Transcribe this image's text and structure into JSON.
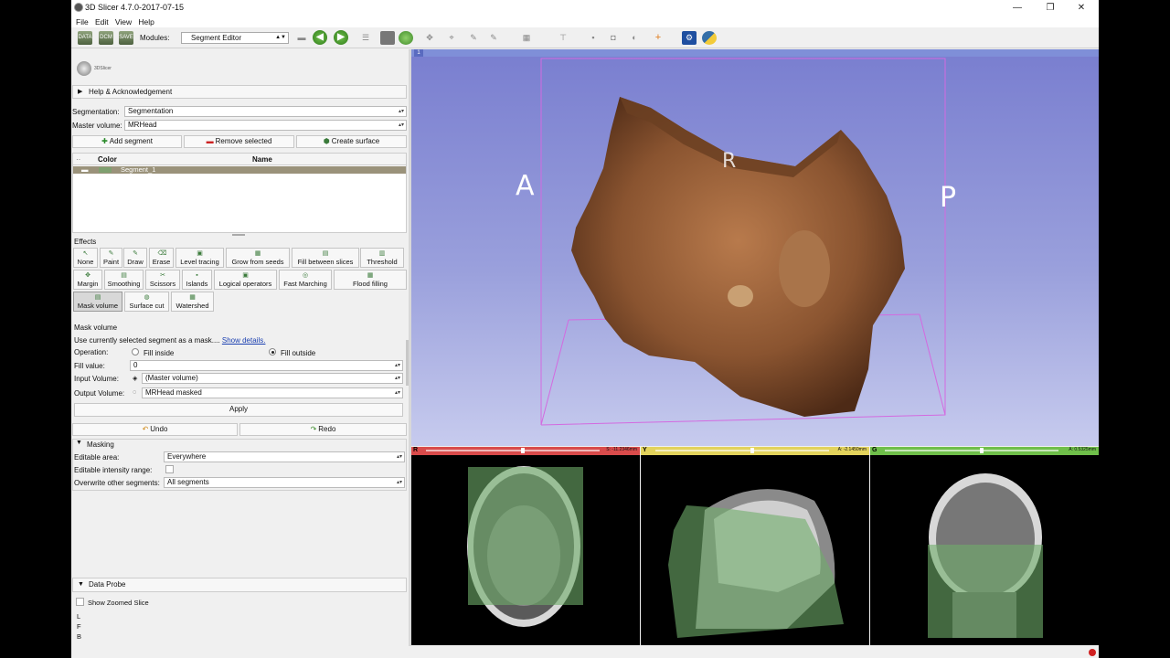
{
  "window": {
    "title": "3D Slicer 4.7.0-2017-07-15",
    "minimize": "—",
    "restore": "❐",
    "close": "✕"
  },
  "menu": {
    "file": "File",
    "edit": "Edit",
    "view": "View",
    "help": "Help"
  },
  "toolbar": {
    "modules_label": "Modules:",
    "module_value": "Segment Editor",
    "data_label": "DATA",
    "dcm_label": "DCM",
    "save_label": "SAVE"
  },
  "logo_text": "3DSlicer",
  "help": {
    "label": "Help & Acknowledgement"
  },
  "segmentation": {
    "label": "Segmentation:",
    "value": "Segmentation"
  },
  "master_volume": {
    "label": "Master volume:",
    "value": "MRHead"
  },
  "segment_buttons": {
    "add": "Add segment",
    "remove": "Remove selected",
    "surface": "Create surface"
  },
  "segment_table": {
    "col_color": "Color",
    "col_name": "Name",
    "rows": [
      {
        "name": "Segment_1"
      }
    ]
  },
  "effects": {
    "label": "Effects",
    "row1": [
      "None",
      "Paint",
      "Draw",
      "Erase",
      "Level tracing",
      "Grow from seeds",
      "Fill between slices",
      "Threshold"
    ],
    "row2": [
      "Margin",
      "Smoothing",
      "Scissors",
      "Islands",
      "Logical operators",
      "Fast Marching",
      "Flood filling"
    ],
    "row3": [
      "Mask volume",
      "Surface cut",
      "Watershed"
    ]
  },
  "mask_volume": {
    "title": "Mask volume",
    "description": "Use currently selected segment as a mask....",
    "show_details": "Show details.",
    "operation_label": "Operation:",
    "fill_inside": "Fill inside",
    "fill_outside": "Fill outside",
    "fill_value_label": "Fill value:",
    "fill_value": "0",
    "input_label": "Input Volume:",
    "input_value": "(Master volume)",
    "output_label": "Output Volume:",
    "output_value": "MRHead masked",
    "apply": "Apply"
  },
  "history": {
    "undo": "Undo",
    "redo": "Redo"
  },
  "masking": {
    "label": "Masking",
    "editable_area_label": "Editable area:",
    "editable_area_value": "Everywhere",
    "intensity_label": "Editable intensity range:",
    "overwrite_label": "Overwrite other segments:",
    "overwrite_value": "All segments"
  },
  "data_probe": {
    "label": "Data Probe",
    "show_zoomed": "Show Zoomed Slice",
    "l": "L",
    "f": "F",
    "b": "B"
  },
  "view3d": {
    "number": "1",
    "left_label": "A",
    "right_label": "P",
    "top_label": "R"
  },
  "slices": [
    {
      "tag": "R",
      "value": "S: -11.2346mm",
      "color": "#d94b4b"
    },
    {
      "tag": "Y",
      "value": "A: -2.1450mm",
      "color": "#e3d35c"
    },
    {
      "tag": "G",
      "value": "A: 0.5325mm",
      "color": "#6fbf4a"
    }
  ]
}
